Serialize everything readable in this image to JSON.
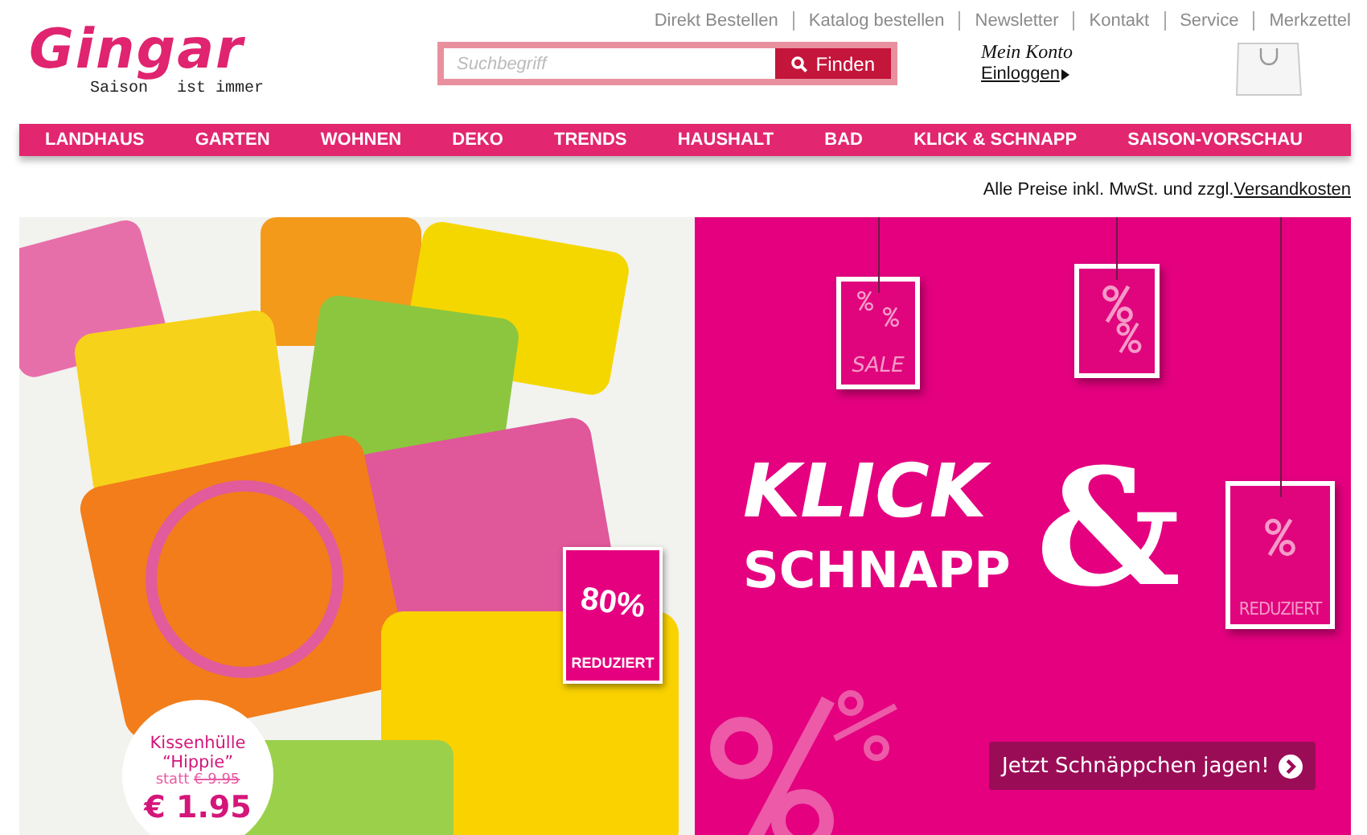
{
  "logo": {
    "name": "Gingar",
    "tagline_left": "Saison",
    "tagline_right": "ist immer"
  },
  "top_links": [
    "Direkt Bestellen",
    "Katalog bestellen",
    "Newsletter",
    "Kontakt",
    "Service",
    "Merkzettel"
  ],
  "search": {
    "placeholder": "Suchbegriff",
    "button": "Finden"
  },
  "account": {
    "title": "Mein Konto",
    "login": "Einloggen"
  },
  "nav": [
    "LANDHAUS",
    "GARTEN",
    "WOHNEN",
    "DEKO",
    "TRENDS",
    "HAUSHALT",
    "BAD",
    "KLICK & SCHNAPP",
    "SAISON-VORSCHAU"
  ],
  "price_note": {
    "text": "Alle Preise inkl. MwSt. und zzgl.",
    "link": "Versandkosten"
  },
  "banner": {
    "photo_tag": {
      "value": "80%",
      "label": "REDUZIERT"
    },
    "price_badge": {
      "product": "Kissenhülle",
      "name": "“Hippie”",
      "was_prefix": "statt",
      "was": "€ 9.95",
      "price": "€ 1.95"
    },
    "tags": [
      {
        "kind": "sale",
        "label": "SALE"
      },
      {
        "kind": "percent"
      },
      {
        "kind": "reduced",
        "label": "REDUZIERT"
      }
    ],
    "headline": {
      "line1": "KLICK",
      "amp": "&",
      "line2": "SCHNAPP"
    },
    "cta": "Jetzt Schnäppchen jagen!"
  }
}
